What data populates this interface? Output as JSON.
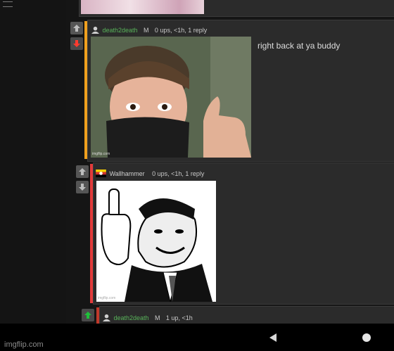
{
  "comments": [
    {
      "username": "death2death",
      "gender_badge": "M",
      "meta": "0 ups, <1h, 1 reply",
      "body_text": "right back at ya buddy",
      "bar_color": "#f0a01e",
      "vote_state": "down",
      "image_desc": "selfie-thumbs-up-mask",
      "image_watermark": "imgflip.com"
    },
    {
      "username": "Wallhammer",
      "meta": "0 ups, <1h, 1 reply",
      "bar_color": "#e23b3b",
      "vote_state": "none",
      "image_desc": "retro-man-middle-finger-meme",
      "image_watermark": "imgflip.com"
    },
    {
      "username": "death2death",
      "gender_badge": "M",
      "meta": "1 up, <1h",
      "bar_color": "#c0392b",
      "vote_state": "up"
    }
  ],
  "footer": {
    "watermark": "imgflip.com"
  },
  "nav": {
    "back_icon": "triangle-back-icon",
    "home_icon": "circle-home-icon"
  },
  "colors": {
    "upvote": "#1fbf3a",
    "downvote": "#ff3b2f",
    "username": "#58b35a"
  }
}
